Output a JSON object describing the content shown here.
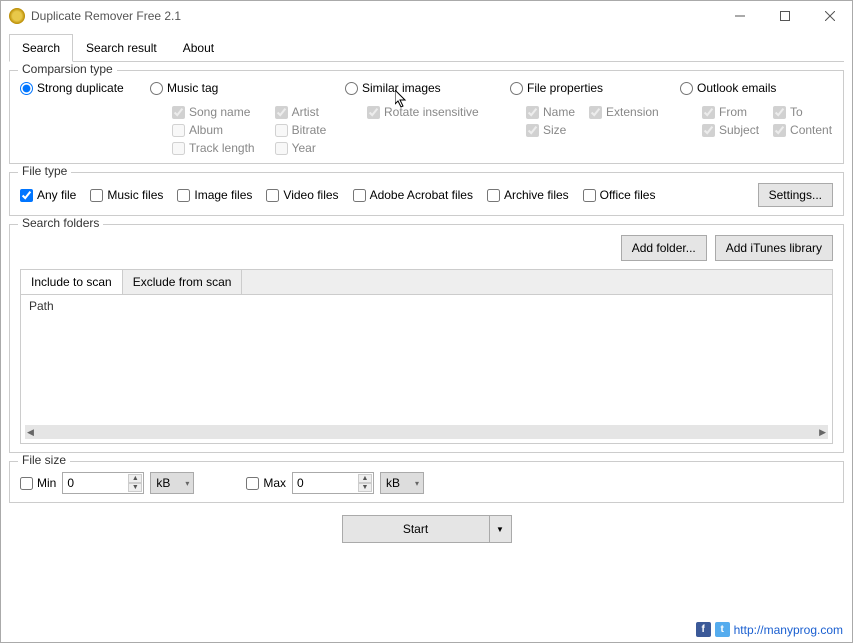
{
  "window": {
    "title": "Duplicate Remover Free 2.1"
  },
  "tabs": {
    "search": "Search",
    "result": "Search result",
    "about": "About"
  },
  "comparison": {
    "label": "Comparsion type",
    "strong": "Strong duplicate",
    "music": "Music tag",
    "music_opts": {
      "song": "Song name",
      "artist": "Artist",
      "album": "Album",
      "bitrate": "Bitrate",
      "track": "Track length",
      "year": "Year"
    },
    "similar": "Similar images",
    "similar_opts": {
      "rotate": "Rotate insensitive"
    },
    "fileprops": "File properties",
    "fileprops_opts": {
      "name": "Name",
      "ext": "Extension",
      "size": "Size"
    },
    "outlook": "Outlook emails",
    "outlook_opts": {
      "from": "From",
      "to": "To",
      "subject": "Subject",
      "content": "Content"
    }
  },
  "filetype": {
    "label": "File type",
    "any": "Any file",
    "music": "Music files",
    "image": "Image files",
    "video": "Video files",
    "adobe": "Adobe Acrobat files",
    "archive": "Archive files",
    "office": "Office files",
    "settings": "Settings..."
  },
  "folders": {
    "label": "Search folders",
    "add_folder": "Add folder...",
    "add_itunes": "Add iTunes library",
    "include": "Include to scan",
    "exclude": "Exclude from scan",
    "path": "Path"
  },
  "filesize": {
    "label": "File size",
    "min": "Min",
    "max": "Max",
    "min_val": "0",
    "max_val": "0",
    "unit": "kB"
  },
  "start": "Start",
  "footer": {
    "url": "http://manyprog.com"
  }
}
